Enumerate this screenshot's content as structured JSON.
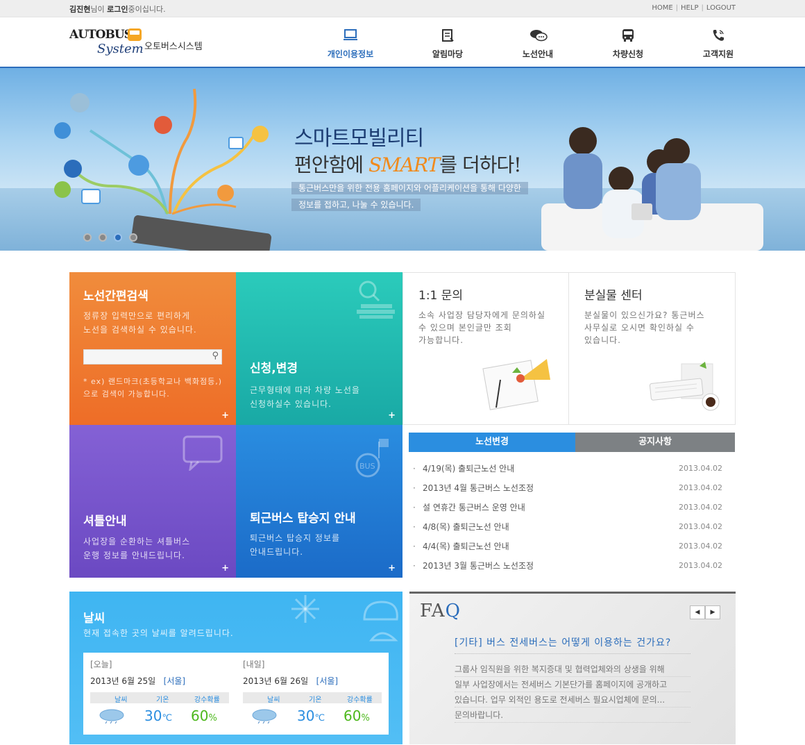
{
  "topbar": {
    "user": "김진현",
    "user_suffix": "님이",
    "login_word": "로그인",
    "login_suffix": "중이십니다.",
    "links": [
      "HOME",
      "HELP",
      "LOGOUT"
    ]
  },
  "logo": {
    "brand_top": "AUTOBUS",
    "brand_bottom": "System",
    "brand_kr": "오토버스시스템"
  },
  "nav": [
    {
      "label": "개인이용정보",
      "icon": "monitor-icon",
      "active": true
    },
    {
      "label": "알림마당",
      "icon": "notepad-icon",
      "active": false
    },
    {
      "label": "노선안내",
      "icon": "chat-bubble-icon",
      "active": false
    },
    {
      "label": "차량신청",
      "icon": "bus-icon",
      "active": false
    },
    {
      "label": "고객지원",
      "icon": "phone-icon",
      "active": false
    }
  ],
  "banner": {
    "headline1": "스마트모빌리티",
    "headline2_pre": "편안함에 ",
    "headline2_smart": "SMART",
    "headline2_post": "를 더하다!",
    "sub1": "통근버스만을 위한 전용 홈페이지와 어플리케이션을 통해 다양한",
    "sub2": "정보를 접하고, 나눌 수 있습니다.",
    "slides": 4,
    "active_slide": 3
  },
  "tiles": {
    "search": {
      "title": "노선간편검색",
      "desc1": "정류장 입력만으로 편리하게",
      "desc2": "노선을 검색하실 수 있습니다.",
      "note1": "* ex) 랜드마크(초등학교나 백화점등,)",
      "note2": "으로 검색이 가능합니다.",
      "plus": "+"
    },
    "apply": {
      "title": "신청,변경",
      "desc1": "근무형태에 따라 차량 노선을",
      "desc2": "신청하실수 있습니다.",
      "plus": "+"
    },
    "shuttle": {
      "title": "셔틀안내",
      "desc1": "사업장을 순환하는 셔틀버스",
      "desc2": "운행 정보를 안내드립니다.",
      "plus": "+"
    },
    "evening": {
      "title": "퇴근버스 탑승지 안내",
      "desc1": "퇴근버스 탑승지 정보를",
      "desc2": "안내드립니다.",
      "plus": "+"
    },
    "inquiry": {
      "title": "1:1 문의",
      "desc1": "소속 사업장 담당자에게 문의하실",
      "desc2": "수 있으며 본인글만 조회",
      "desc3": "가능합니다."
    },
    "lost": {
      "title": "분실물 센터",
      "desc1": "분실물이 있으신가요? 통근버스",
      "desc2": "사무실로 오시면 확인하실 수",
      "desc3": "있습니다."
    }
  },
  "board": {
    "tabs": [
      "노선변경",
      "공지사항"
    ],
    "active_tab": 0,
    "items": [
      {
        "title": "4/19(목) 출퇴근노선 안내",
        "date": "2013.04.02"
      },
      {
        "title": "2013년 4월 통근버스 노선조정",
        "date": "2013.04.02"
      },
      {
        "title": "설 연휴간 통근버스 운영 안내",
        "date": "2013.04.02"
      },
      {
        "title": "4/8(목) 출퇴근노선 안내",
        "date": "2013.04.02"
      },
      {
        "title": "4/4(목) 출퇴근노선 안내",
        "date": "2013.04.02"
      },
      {
        "title": "2013년 3월 통근버스 노선조정",
        "date": "2013.04.02"
      }
    ]
  },
  "weather": {
    "title": "날씨",
    "desc": "현재 접속한 곳의 날씨를 알려드립니다.",
    "columns": [
      "날씨",
      "기온",
      "강수확률"
    ],
    "days": [
      {
        "label": "[오늘]",
        "date": "2013년 6월 25일",
        "city": "[서울]",
        "temp": "30",
        "temp_unit": "℃",
        "rain": "60",
        "rain_unit": "%"
      },
      {
        "label": "[내일]",
        "date": "2013년 6월 26일",
        "city": "[서울]",
        "temp": "30",
        "temp_unit": "℃",
        "rain": "60",
        "rain_unit": "%"
      }
    ]
  },
  "faq": {
    "logo_f": "FA",
    "logo_q": "Q",
    "question": "[기타] 버스 전세버스는 어떻게 이용하는 건가요?",
    "answer": [
      "그룹사 임직원을 위한 복지증대 및 협력업체와의 상생을 위해",
      "일부 사업장에서는 전세버스 기본단가를 홈페이지에 공개하고",
      "있습니다.  업무 외적인 용도로 전세버스 필요시업체에 문의...",
      "문의바랍니다."
    ],
    "prev": "◀",
    "next": "▶"
  },
  "colors": {
    "accent": "#2b6dbb",
    "orange": "#ee6d27",
    "teal": "#19a9a5",
    "purple": "#6b49c2",
    "blue": "#1b6bc8",
    "sky": "#52bef5"
  }
}
